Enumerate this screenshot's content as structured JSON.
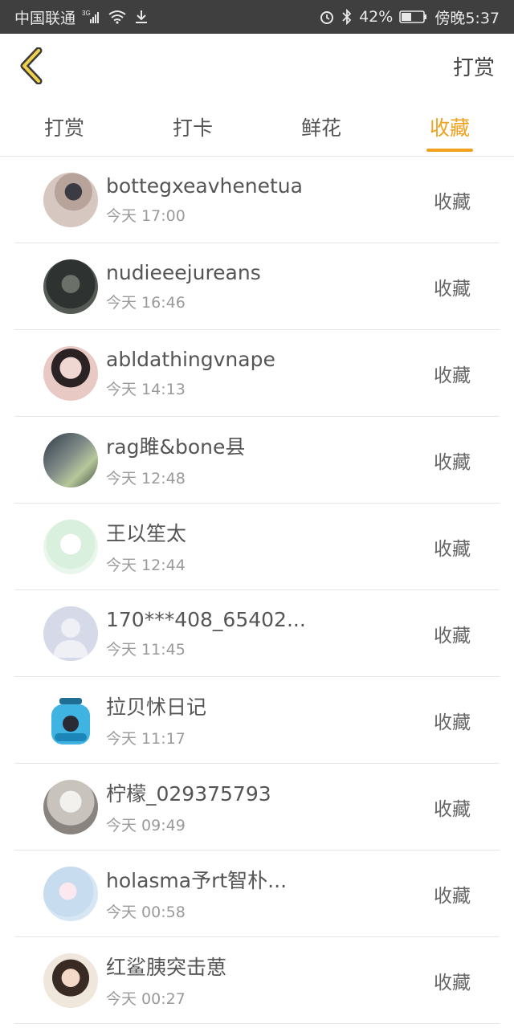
{
  "status_bar": {
    "carrier": "中国联通",
    "network": "3G",
    "battery": "42%",
    "time": "傍晚5:37",
    "icons": [
      "signal-icon",
      "wifi-icon",
      "download-icon",
      "alarm-icon",
      "bluetooth-icon",
      "battery-icon"
    ]
  },
  "header": {
    "back_icon": "chevron-left-icon",
    "action": "打赏"
  },
  "tabs": [
    {
      "label": "打赏",
      "active": false
    },
    {
      "label": "打卡",
      "active": false
    },
    {
      "label": "鲜花",
      "active": false
    },
    {
      "label": "收藏",
      "active": true
    }
  ],
  "colors": {
    "accent": "#f0a11e",
    "status_bar": "#3f3f3f"
  },
  "list": [
    {
      "name": "bottegxeavhenetua",
      "time": "今天 17:00",
      "action": "收藏",
      "avatar": "person-photo-avatar"
    },
    {
      "name": "nudieeejureans",
      "time": "今天 16:46",
      "action": "收藏",
      "avatar": "dark-photo-avatar"
    },
    {
      "name": "abldathingvnape",
      "time": "今天 14:13",
      "action": "收藏",
      "avatar": "woman-portrait-avatar"
    },
    {
      "name": "rag雎&bone县",
      "time": "今天 12:48",
      "action": "收藏",
      "avatar": "street-photo-avatar"
    },
    {
      "name": "王以笙太",
      "time": "今天 12:44",
      "action": "收藏",
      "avatar": "anime-sketch-avatar"
    },
    {
      "name": "170***408_65402...",
      "time": "今天 11:45",
      "action": "收藏",
      "avatar": "default-user-avatar"
    },
    {
      "name": "拉贝怵日记",
      "time": "今天 11:17",
      "action": "收藏",
      "avatar": "jar-illustration-avatar"
    },
    {
      "name": "柠檬_029375793",
      "time": "今天 09:49",
      "action": "收藏",
      "avatar": "light-photo-avatar"
    },
    {
      "name": "holasma予rt智朴...",
      "time": "今天 00:58",
      "action": "收藏",
      "avatar": "pastel-photo-avatar"
    },
    {
      "name": "红鲨胰突击葸",
      "time": "今天 00:27",
      "action": "收藏",
      "avatar": "girl-portrait-avatar"
    }
  ]
}
